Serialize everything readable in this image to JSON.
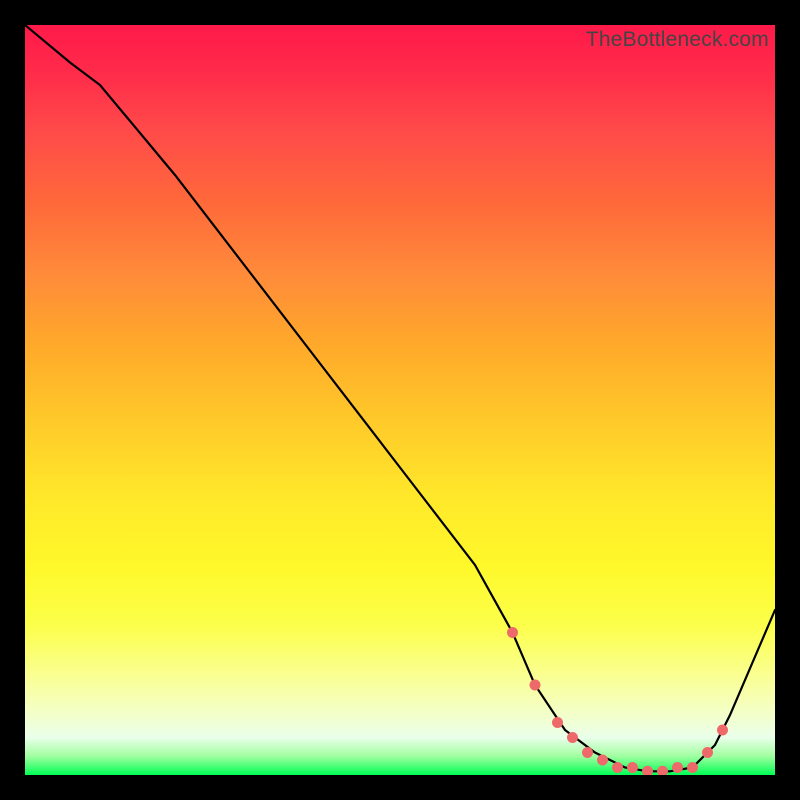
{
  "watermark": "TheBottleneck.com",
  "chart_data": {
    "type": "line",
    "title": "",
    "xlabel": "",
    "ylabel": "",
    "xlim": [
      0,
      100
    ],
    "ylim": [
      0,
      100
    ],
    "series": [
      {
        "name": "curve",
        "x": [
          0,
          6,
          10,
          20,
          30,
          40,
          50,
          60,
          65,
          68,
          72,
          76,
          80,
          83,
          86,
          89,
          92,
          94,
          100
        ],
        "y": [
          100,
          95,
          92,
          80,
          67,
          54,
          41,
          28,
          19,
          12,
          6,
          3,
          1,
          0.5,
          0.5,
          1,
          4,
          8,
          22
        ]
      }
    ],
    "markers": {
      "name": "bottom-dots",
      "x": [
        65,
        68,
        71,
        73,
        75,
        77,
        79,
        81,
        83,
        85,
        87,
        89,
        91,
        93
      ],
      "y": [
        19,
        12,
        7,
        5,
        3,
        2,
        1,
        1,
        0.5,
        0.5,
        1,
        1,
        3,
        6
      ]
    },
    "gradient_stops": [
      {
        "pos": 0.0,
        "color": "#ff1a4a"
      },
      {
        "pos": 0.5,
        "color": "#ffd000"
      },
      {
        "pos": 0.92,
        "color": "#f5ffc0"
      },
      {
        "pos": 1.0,
        "color": "#00ff55"
      }
    ]
  }
}
